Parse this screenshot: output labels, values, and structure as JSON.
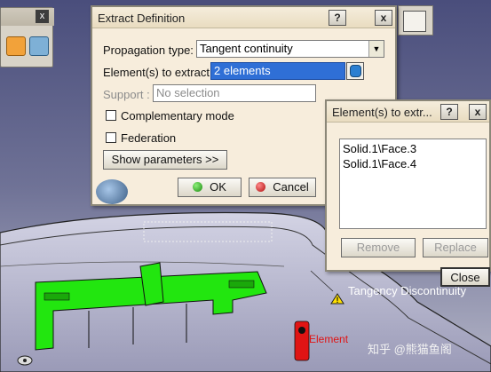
{
  "extract_dialog": {
    "title": "Extract Definition",
    "help_btn": "?",
    "close_btn": "x",
    "propagation_label": "Propagation type:",
    "propagation_value": "Tangent continuity",
    "elements_label": "Element(s) to extract",
    "elements_value": "2 elements",
    "support_label": "Support :",
    "support_value": "No selection",
    "complementary_label": "Complementary mode",
    "federation_label": "Federation",
    "show_params_label": "Show parameters >>",
    "ok_label": "OK",
    "cancel_label": "Cancel"
  },
  "elements_dialog": {
    "title": "Element(s) to extr...",
    "help_btn": "?",
    "close_btn": "x",
    "items": [
      "Solid.1\\Face.3",
      "Solid.1\\Face.4"
    ],
    "remove_label": "Remove",
    "replace_label": "Replace",
    "close_label": "Close"
  },
  "viewport": {
    "tangency_label": "Tangency Discontinuity",
    "element_label": "Element",
    "watermark": "知乎 @熊猫鱼阁",
    "highlight_color": "#22e60f",
    "selected_color": "#e01414"
  },
  "palette": {
    "close_btn": "x"
  }
}
